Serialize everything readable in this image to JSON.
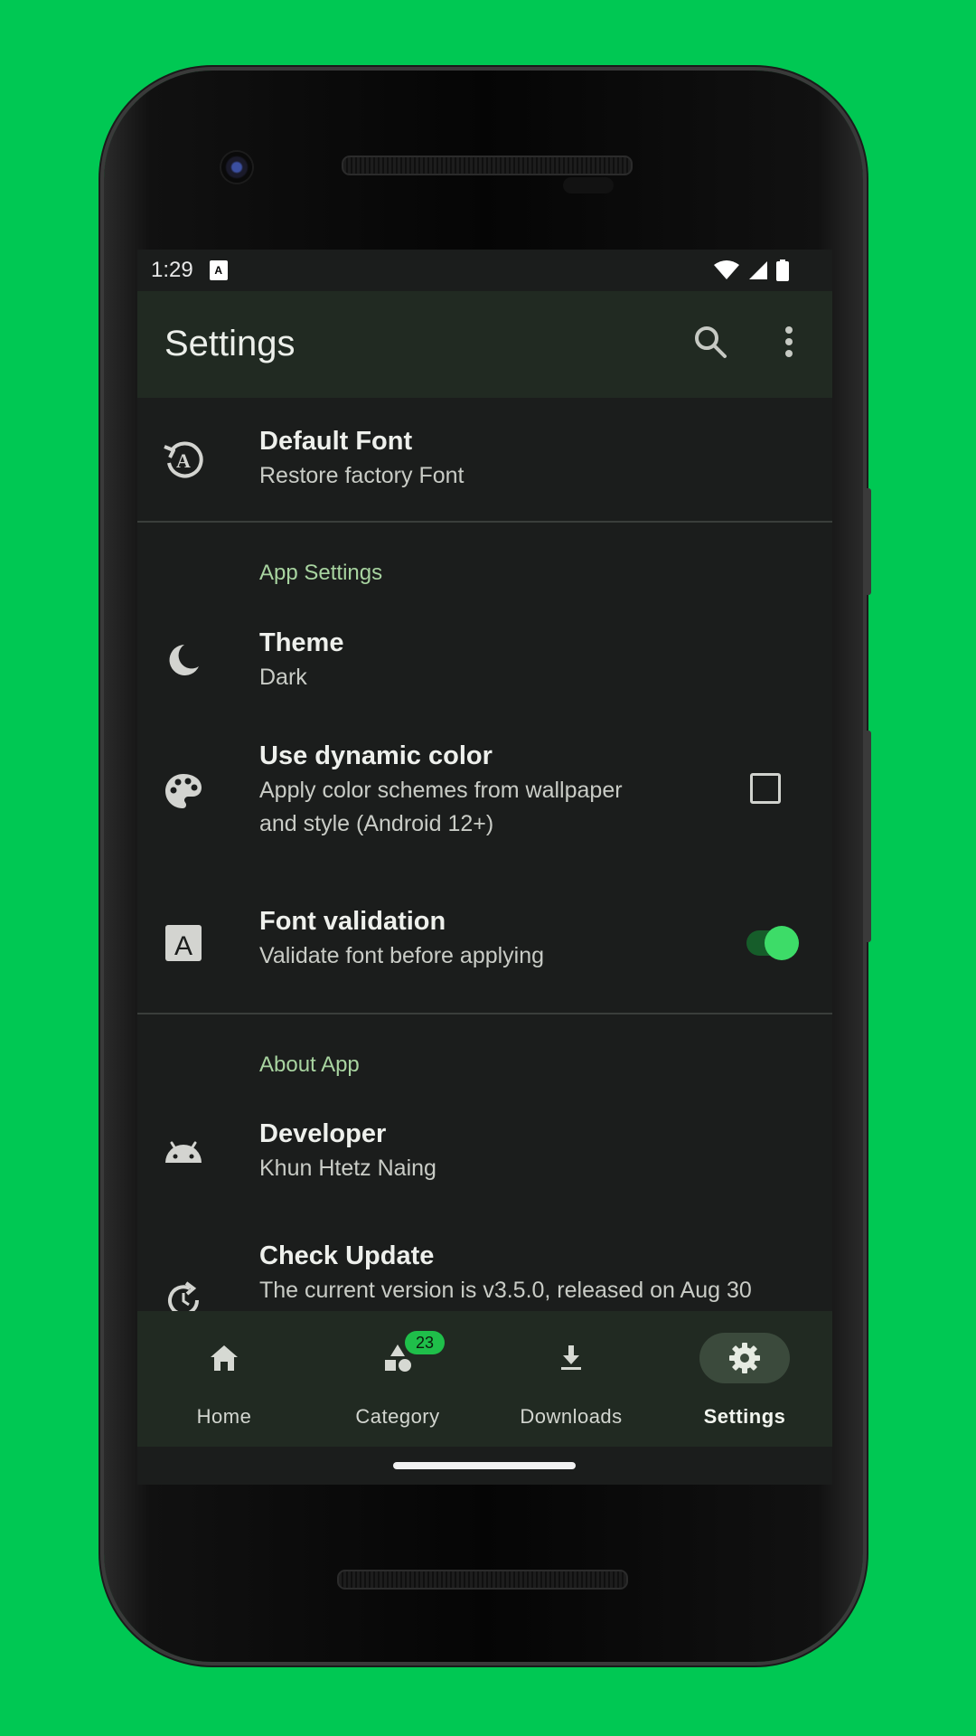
{
  "status_bar": {
    "time": "1:29",
    "notification_icon": "A",
    "icons": [
      "wifi-icon",
      "signal-icon",
      "battery-icon"
    ]
  },
  "app_bar": {
    "title": "Settings",
    "actions": [
      "search-icon",
      "more-vert-icon"
    ]
  },
  "items": {
    "default_font": {
      "title": "Default Font",
      "subtitle": "Restore factory Font",
      "icon": "restore-font-icon"
    },
    "section_app": "App Settings",
    "theme": {
      "title": "Theme",
      "subtitle": "Dark",
      "icon": "moon-icon"
    },
    "dynamic_color": {
      "title": "Use dynamic color",
      "subtitle_line1": "Apply color schemes from wallpaper",
      "subtitle_line2": "and style (Android 12+)",
      "icon": "palette-icon",
      "checked": false
    },
    "font_validation": {
      "title": "Font validation",
      "subtitle": "Validate font before applying",
      "icon": "font-a-icon",
      "enabled": true
    },
    "section_about": "About App",
    "developer": {
      "title": "Developer",
      "subtitle": "Khun Htetz Naing",
      "icon": "android-icon"
    },
    "check_update": {
      "title": "Check Update",
      "subtitle": "The current version is v3.5.0, released on Aug 30",
      "icon": "update-icon"
    }
  },
  "nav": {
    "home": "Home",
    "category": "Category",
    "category_badge": "23",
    "downloads": "Downloads",
    "settings": "Settings",
    "active": "settings"
  },
  "colors": {
    "background": "#00c853",
    "screen": "#1b1d1c",
    "app_bar": "#212a22",
    "accent": "#3ddc68",
    "section_text": "#a8d4a0"
  }
}
